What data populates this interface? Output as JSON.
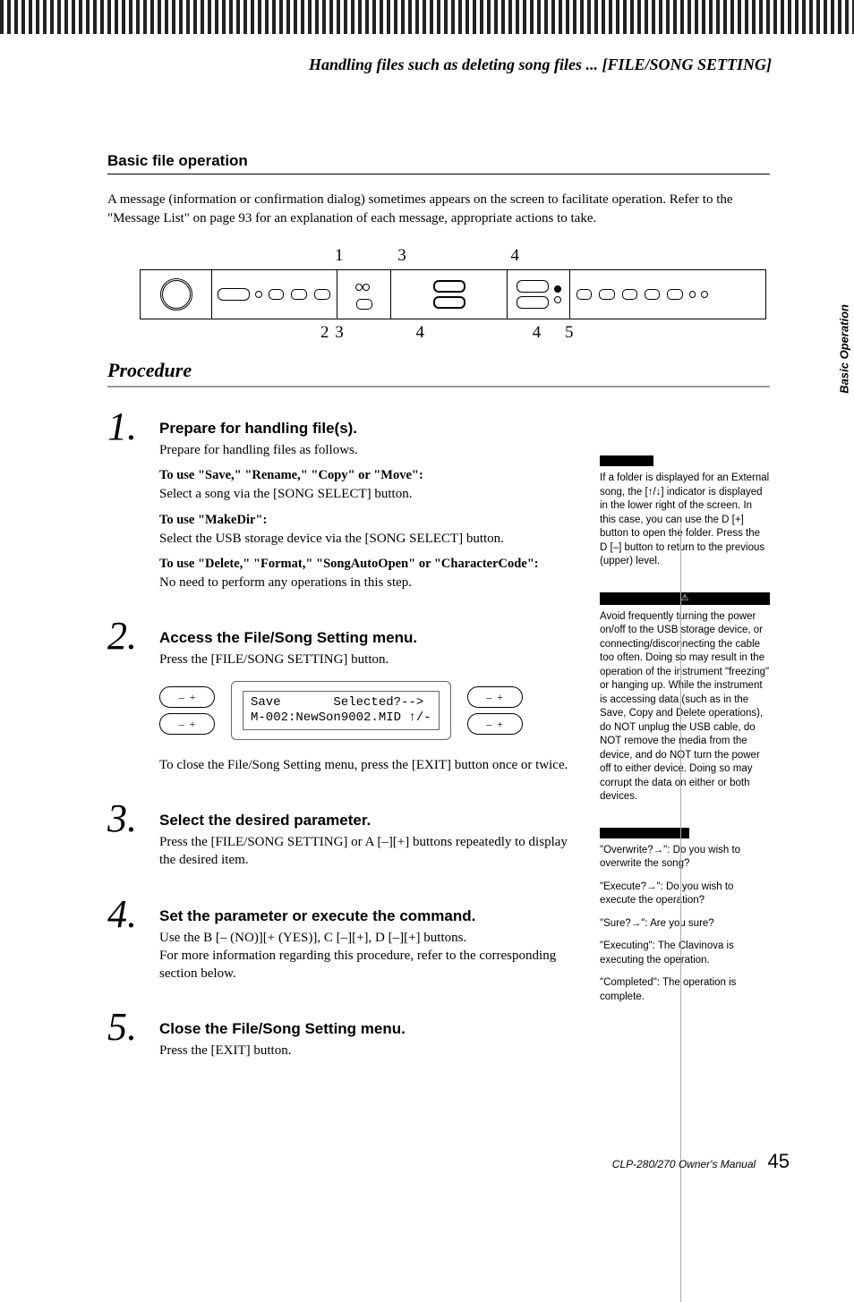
{
  "header": {
    "title": "Handling files such as deleting song files ... [FILE/SONG SETTING]"
  },
  "sideTab": "Basic Operation",
  "sectionTitle": "Basic file operation",
  "introText": "A message (information or confirmation dialog) sometimes appears on the screen to facilitate operation. Refer to the \"Message List\" on page 93 for an explanation of each message, appropriate actions to take.",
  "diagram": {
    "topNums": {
      "n1": "1",
      "n3": "3",
      "n4": "4"
    },
    "botNums": {
      "b2": "2",
      "b3": "3",
      "b4a": "4",
      "b4b": "4",
      "b5": "5"
    }
  },
  "procedureHead": "Procedure",
  "steps": [
    {
      "num": "1.",
      "title": "Prepare for handling file(s).",
      "text": "Prepare for handling files as follows.",
      "subs": [
        {
          "bold": "To use \"Save,\" \"Rename,\" \"Copy\" or \"Move\":",
          "plain": "Select a song via the [SONG SELECT] button."
        },
        {
          "bold": "To use \"MakeDir\":",
          "plain": "Select the USB storage device via the [SONG SELECT] button."
        },
        {
          "bold": "To use \"Delete,\" \"Format,\" \"SongAutoOpen\" or \"CharacterCode\":",
          "plain": "No need to perform any operations in this step."
        }
      ]
    },
    {
      "num": "2.",
      "title": "Access the File/Song Setting menu.",
      "text": "Press the [FILE/SONG SETTING] button.",
      "lcd": {
        "line1": "Save       Selected?-->",
        "line2": "M-002:NewSon9002.MID ↑/-"
      },
      "after": "To close the File/Song Setting menu, press the [EXIT] button once or twice."
    },
    {
      "num": "3.",
      "title": "Select the desired parameter.",
      "text": "Press the [FILE/SONG SETTING] or A [–][+] buttons repeatedly to display the desired item."
    },
    {
      "num": "4.",
      "title": "Set the parameter or execute the command.",
      "text": "Use the B [– (NO)][+ (YES)], C [–][+], D [–][+] buttons.\nFor more information regarding this procedure, refer to the corresponding section below."
    },
    {
      "num": "5.",
      "title": "Close the File/Song Setting menu.",
      "text": "Press the [EXIT] button."
    }
  ],
  "sidebar": {
    "tip": "If a folder is displayed for an External song, the [↑/↓] indicator is displayed in the lower right of the screen. In this case, you can use the D [+] button to open the folder. Press the D [–] button to return to the previous (upper) level.",
    "cautionIcon": "⚠",
    "caution": "Avoid frequently turning the power on/off to the USB storage device, or connecting/disconnecting the cable too often. Doing so may result in the operation of the instrument \"freezing\" or hanging up. While the instrument is accessing data (such as in the Save, Copy and Delete operations), do NOT unplug the USB cable, do NOT remove the media from the device, and do NOT turn the power off to either device. Doing so may corrupt the data on either or both devices.",
    "terms": [
      "\"Overwrite?→\": Do you wish to overwrite the song?",
      "\"Execute?→\": Do you wish to execute the operation?",
      "\"Sure?→\": Are you sure?",
      "\"Executing\": The Clavinova is executing the operation.",
      "\"Completed\": The operation is complete."
    ]
  },
  "footer": {
    "model": "CLP-280/270 Owner's Manual",
    "page": "45"
  }
}
